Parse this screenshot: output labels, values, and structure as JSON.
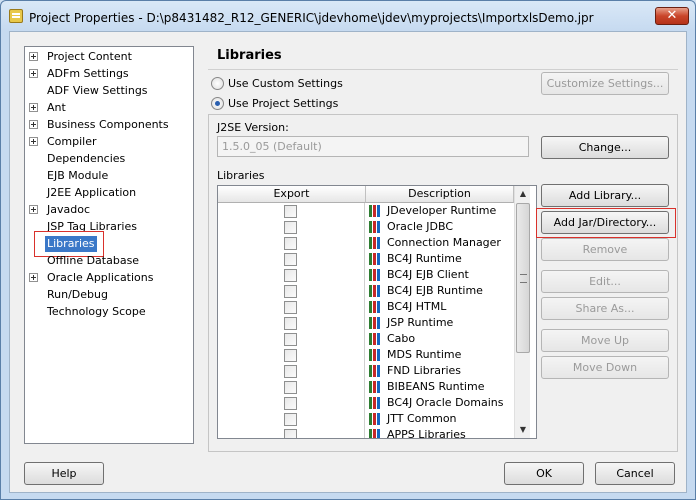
{
  "window": {
    "title": "Project Properties - D:\\p8431482_R12_GENERIC\\jdevhome\\jdev\\myprojects\\ImportxlsDemo.jpr",
    "close_glyph": "✕"
  },
  "tree": {
    "items": [
      {
        "label": "Project Content",
        "expandable": true
      },
      {
        "label": "ADFm Settings",
        "expandable": true
      },
      {
        "label": "ADF View Settings",
        "expandable": false
      },
      {
        "label": "Ant",
        "expandable": true
      },
      {
        "label": "Business Components",
        "expandable": true
      },
      {
        "label": "Compiler",
        "expandable": true
      },
      {
        "label": "Dependencies",
        "expandable": false
      },
      {
        "label": "EJB Module",
        "expandable": false
      },
      {
        "label": "J2EE Application",
        "expandable": false
      },
      {
        "label": "Javadoc",
        "expandable": true
      },
      {
        "label": "JSP Tag Libraries",
        "expandable": false
      },
      {
        "label": "Libraries",
        "expandable": false,
        "selected": true
      },
      {
        "label": "Offline Database",
        "expandable": false
      },
      {
        "label": "Oracle Applications",
        "expandable": true
      },
      {
        "label": "Run/Debug",
        "expandable": false
      },
      {
        "label": "Technology Scope",
        "expandable": false
      }
    ]
  },
  "main": {
    "title": "Libraries",
    "use_custom_label": "Use Custom Settings",
    "use_project_label": "Use Project Settings",
    "customize_button": "Customize Settings...",
    "j2se_label": "J2SE Version:",
    "j2se_value": "1.5.0_05 (Default)",
    "change_button": "Change...",
    "libraries_label": "Libraries",
    "table": {
      "headers": [
        "Export",
        "Description"
      ],
      "rows": [
        "JDeveloper Runtime",
        "Oracle JDBC",
        "Connection Manager",
        "BC4J Runtime",
        "BC4J EJB Client",
        "BC4J EJB Runtime",
        "BC4J HTML",
        "JSP Runtime",
        "Cabo",
        "MDS Runtime",
        "FND Libraries",
        "BIBEANS Runtime",
        "BC4J Oracle Domains",
        "JTT Common",
        "APPS Libraries"
      ]
    },
    "buttons": {
      "add_library": "Add Library...",
      "add_jar": "Add Jar/Directory...",
      "remove": "Remove",
      "edit": "Edit...",
      "share_as": "Share As...",
      "move_up": "Move Up",
      "move_down": "Move Down"
    }
  },
  "footer": {
    "help": "Help",
    "ok": "OK",
    "cancel": "Cancel"
  },
  "colors": {
    "selection": "#3a78c8",
    "annotation": "#d9312b",
    "lib_icon": [
      "#2e7d32",
      "#c62828",
      "#1565c0"
    ]
  }
}
